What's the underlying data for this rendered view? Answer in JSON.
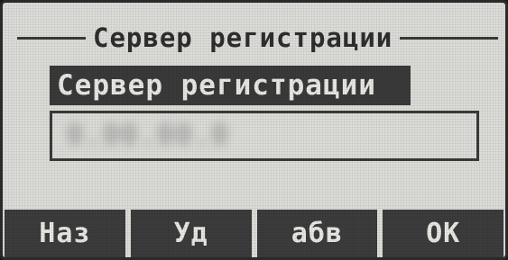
{
  "screen": {
    "title": "Сервер регистрации"
  },
  "field": {
    "label": "Сервер регистрации",
    "value": "0.00.00.0"
  },
  "softkeys": [
    {
      "label": "Наз"
    },
    {
      "label": "Уд"
    },
    {
      "label": "абв"
    },
    {
      "label": "OK"
    }
  ],
  "colors": {
    "lcd_background": "#dcdcd8",
    "lcd_foreground": "#3a3a3a",
    "inverted_text": "#e8e8e4"
  }
}
